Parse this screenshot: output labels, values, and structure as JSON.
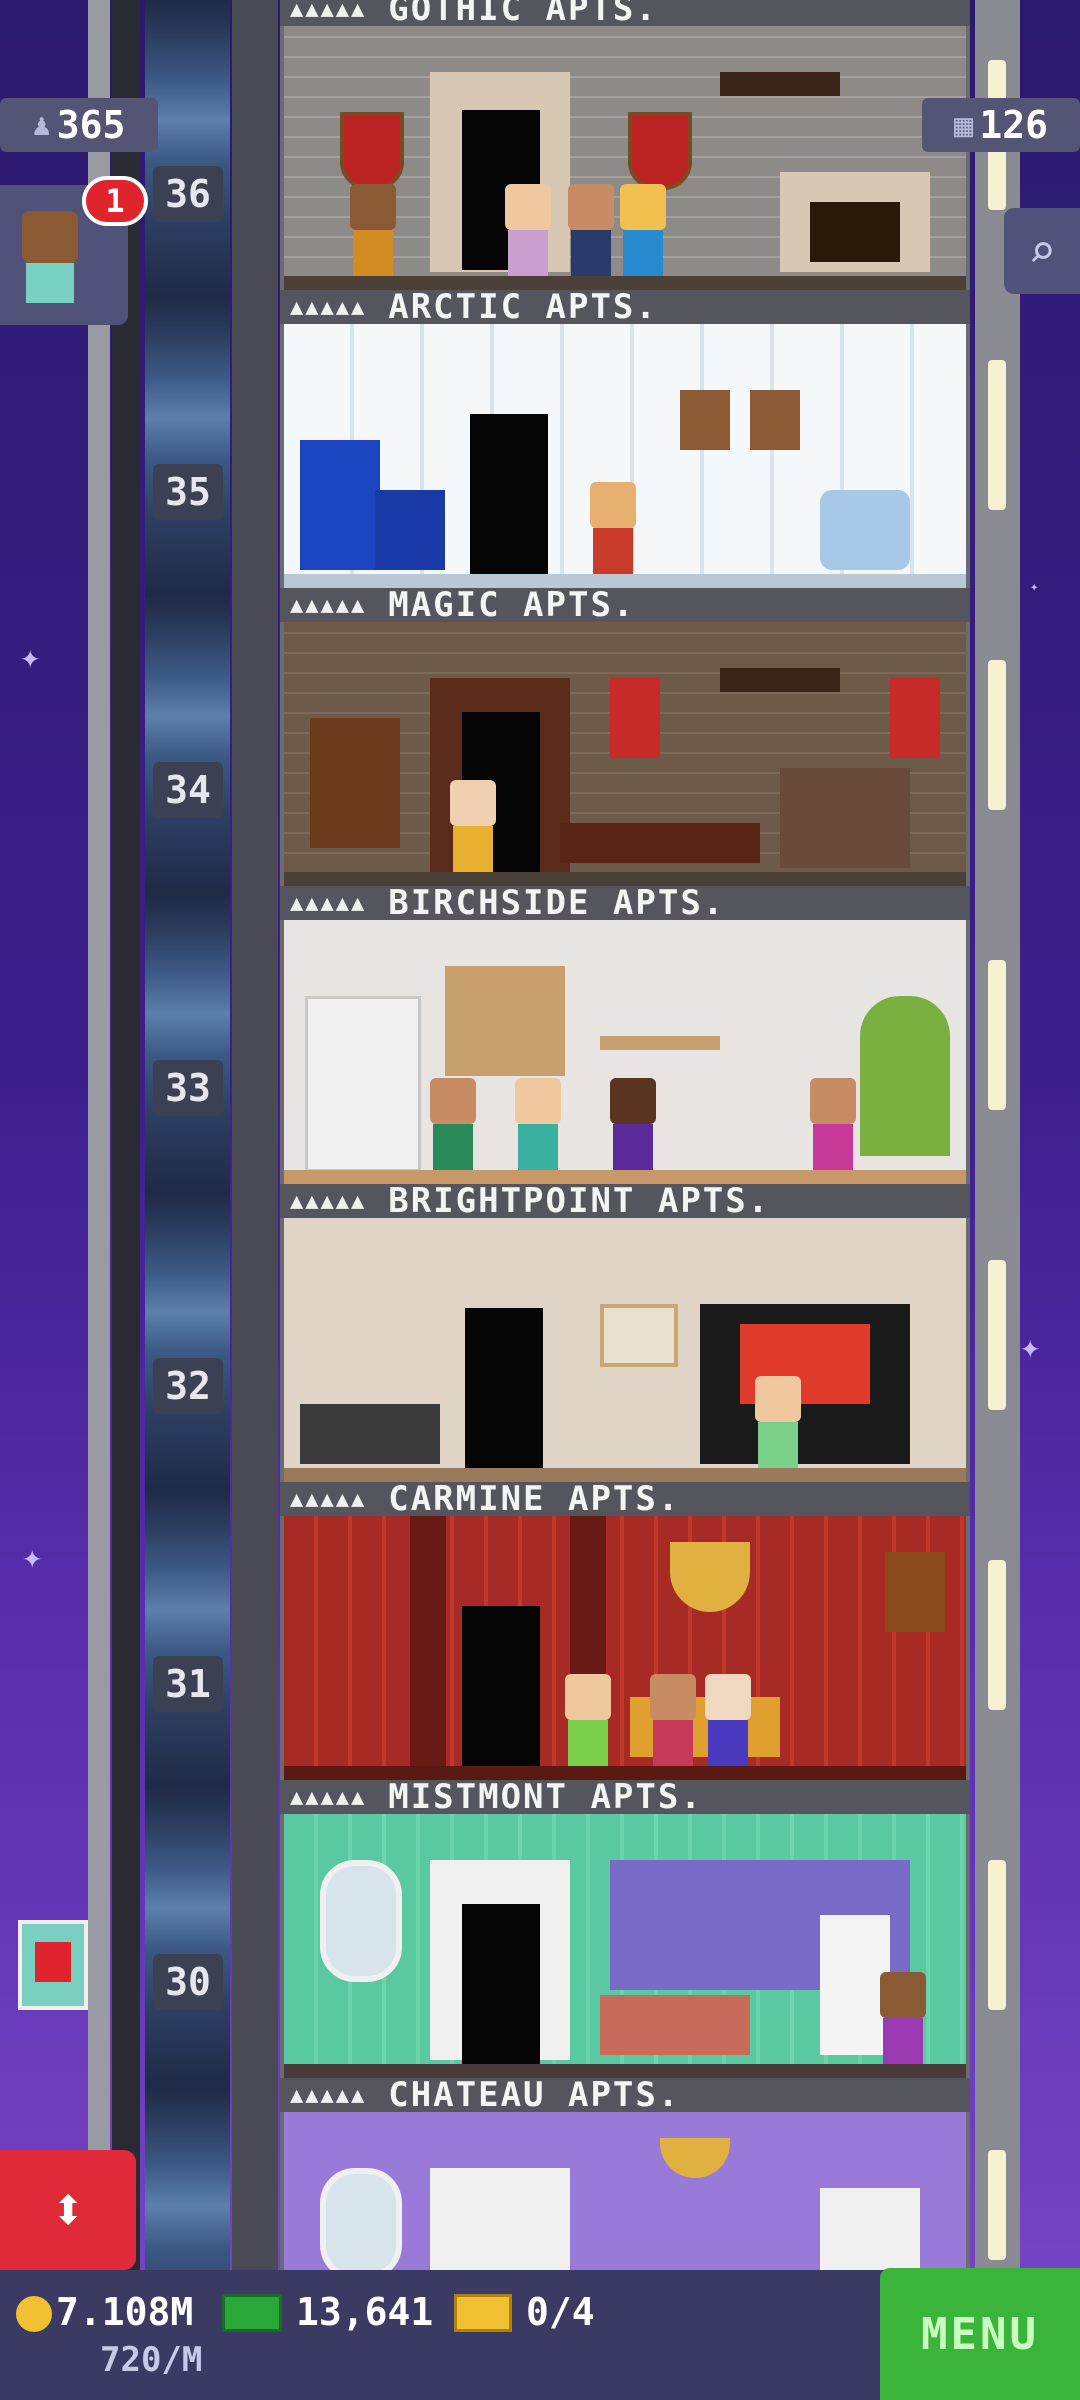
{
  "hud": {
    "population": "365",
    "floors_count": "126",
    "visitor_badge_count": "1",
    "coins": "7.108M",
    "coin_rate": "720/M",
    "bux": "13,641",
    "tickets": "0/4",
    "menu_label": "MENU"
  },
  "floors": [
    {
      "number": "36",
      "stars": "▲▲▲▲▲",
      "name": "GOTHIC APTS."
    },
    {
      "number": "35",
      "stars": "▲▲▲▲▲",
      "name": "ARCTIC APTS."
    },
    {
      "number": "34",
      "stars": "▲▲▲▲▲",
      "name": "MAGIC APTS."
    },
    {
      "number": "33",
      "stars": "▲▲▲▲▲",
      "name": "BIRCHSIDE APTS."
    },
    {
      "number": "32",
      "stars": "▲▲▲▲▲",
      "name": "BRIGHTPOINT APTS."
    },
    {
      "number": "31",
      "stars": "▲▲▲▲▲",
      "name": "CARMINE APTS."
    },
    {
      "number": "30",
      "stars": "▲▲▲▲▲",
      "name": "MISTMONT APTS."
    },
    {
      "number": "",
      "stars": "▲▲▲▲▲",
      "name": "CHATEAU APTS."
    }
  ],
  "top_floor_name": "GOTHIC APTS.",
  "icons": {
    "population": "person-icon",
    "floors": "building-grid-icon",
    "search": "magnifier-icon",
    "coin": "coin-icon",
    "bux": "bux-icon",
    "ticket": "ticket-icon",
    "elevator": "up-down-arrows-icon"
  },
  "colors": {
    "sky": "#3d1f8c",
    "menu_green": "#3bb43b",
    "elevator_red": "#e02a3a",
    "badge_red": "#e0242e"
  }
}
